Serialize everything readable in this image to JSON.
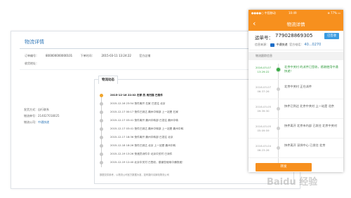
{
  "desktop": {
    "title": "物流详情",
    "meta": {
      "order_label": "订单编号：",
      "order_value": "800000000000101",
      "time_label": "下单时间：",
      "time_value": "2015-03-11 13:24:22",
      "shop": "官方店铺",
      "addr_label": "收货地址："
    },
    "info": {
      "ship_method": "发货方式：自行联系",
      "tracking": "物流单号：214027018025",
      "company_label": "物流公司：",
      "company": "中通快递"
    },
    "tab": "物流动态",
    "events": [
      "2015-12-16 22:02  石家 的 用扫描 已揽件",
      "2015-12-16 23:54  快件离开 石家 已发往 北京",
      "2015-12-17 00:17  快件已到达 鼎州中转部 上一站是 石家",
      "2015-12-17 03:41  快件离开 鼎州中转部 已发往 鼎州中转",
      "2015-12-17 03:41  快件已到达 鼎州中转部 上一站是 鼎州中转",
      "2015-12-17 18:36  快件离开 鼎州中转部 已发往 北京",
      "2015-12-18 18:26  快件已到达 北京 上一站是 鼎州中转",
      "2015-12-19 13:26  快递员派件中 北京中关村 已派件",
      "2015-12-19 12:40  北京中关村 已签收，感谢您使用中通快递！"
    ],
    "note": "数据仅供参考，以物流公司官方数据为准，如有疑问请致电物流公司"
  },
  "phone": {
    "status_left": "●●●●○ 中国移动",
    "status_center": "10:49",
    "status_right": "⊕ 77% ▭",
    "nav_back": "‹",
    "nav_title": "物流详情",
    "waybill_label": "运单号：",
    "waybill_number": "779028869305",
    "badge": "已签收",
    "source_label": "信息来源：",
    "carrier": "中通快递",
    "phone_label": "官方电话：",
    "phone_value": "40...0270",
    "section_title": "物流跟踪信息",
    "events": [
      {
        "date": "2016-03-07",
        "time": "13:29:22",
        "text": "北京中关村 的派件已签收，感谢使用中通快递！"
      },
      {
        "date": "2016-03-07",
        "time": "06:37:26",
        "text": "北京中关村 正在派件"
      },
      {
        "date": "2016-03-05",
        "time": "09:39:30",
        "text": "快件已到达 北京中关村 上一站是 北京"
      },
      {
        "date": "2016-03-05",
        "time": "05:09:59",
        "text": "快件离开 北京市内部 已发往 北京中关村"
      },
      {
        "date": "2016-03-04",
        "time": "06:23:26",
        "text": "快件离开 深圳中心 已发往 北京"
      }
    ],
    "share_label": "转发"
  },
  "watermark": "Baidu 经验",
  "colors": {
    "accent": "#f7901e",
    "link": "#2f77b8",
    "success": "#39a845"
  }
}
